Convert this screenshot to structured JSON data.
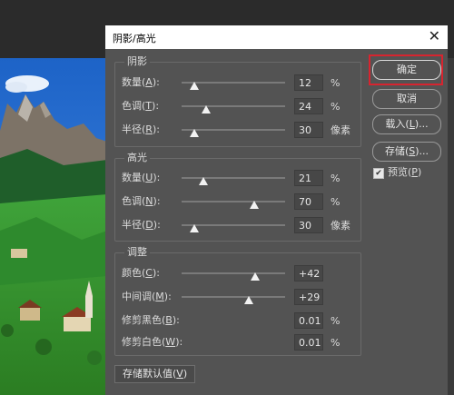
{
  "dialog": {
    "title": "阴影/高光"
  },
  "shadows": {
    "legend": "阴影",
    "rows": [
      {
        "label": "数量(",
        "key": "A",
        "value": "12",
        "unit": "%",
        "level": 0.12
      },
      {
        "label": "色调(",
        "key": "T",
        "value": "24",
        "unit": "%",
        "level": 0.24
      },
      {
        "label": "半径(",
        "key": "R",
        "value": "30",
        "unit": "像素",
        "level": 0.12
      }
    ]
  },
  "highlights": {
    "legend": "高光",
    "rows": [
      {
        "label": "数量(",
        "key": "U",
        "value": "21",
        "unit": "%",
        "level": 0.21
      },
      {
        "label": "色调(",
        "key": "N",
        "value": "70",
        "unit": "%",
        "level": 0.7
      },
      {
        "label": "半径(",
        "key": "D",
        "value": "30",
        "unit": "像素",
        "level": 0.12
      }
    ]
  },
  "adjust": {
    "legend": "调整",
    "color": {
      "label": "颜色(",
      "key": "C",
      "value": "+42",
      "level": 0.71
    },
    "midtone": {
      "label": "中间调(",
      "key": "M",
      "value": "+29",
      "level": 0.65
    },
    "clip_black": {
      "label": "修剪黑色(",
      "key": "B",
      "value": "0.01",
      "unit": "%"
    },
    "clip_white": {
      "label": "修剪白色(",
      "key": "W",
      "value": "0.01",
      "unit": "%"
    }
  },
  "buttons": {
    "ok": "确定",
    "cancel": "取消",
    "load": "载入(",
    "load_key": "L",
    "load_suffix": ")...",
    "save": "存储(",
    "save_key": "S",
    "save_suffix": ")..."
  },
  "preview": {
    "label": "预览(",
    "key": "P",
    "checked": true
  },
  "save_default": {
    "label": "存储默认值(",
    "key": "V"
  },
  "paren_close": ")"
}
